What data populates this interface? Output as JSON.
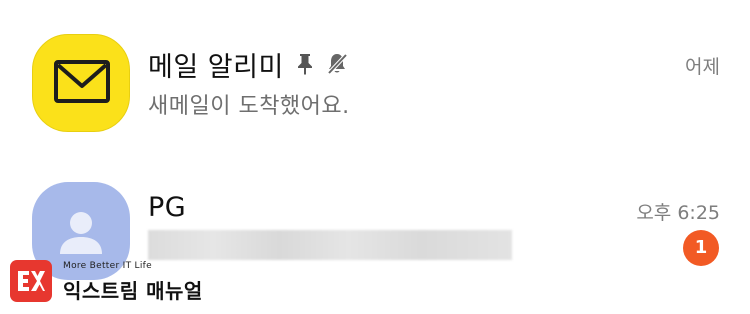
{
  "chats": [
    {
      "name": "메일 알리미",
      "preview": "새메일이 도착했어요.",
      "time": "어제",
      "avatar_icon": "mail-envelope-icon",
      "avatar_color": "#fbe11a",
      "pinned": true,
      "muted": true
    },
    {
      "name": "PG",
      "preview_redacted": true,
      "time": "오후 6:25",
      "unread_count": "1",
      "avatar_icon": "default-user-icon",
      "avatar_color": "#a7b9ea",
      "badge_color": "#f25a24"
    }
  ],
  "watermark": {
    "tagline": "More Better IT Life",
    "title": "익스트림 매뉴얼",
    "logo_color": "#e7372f"
  }
}
